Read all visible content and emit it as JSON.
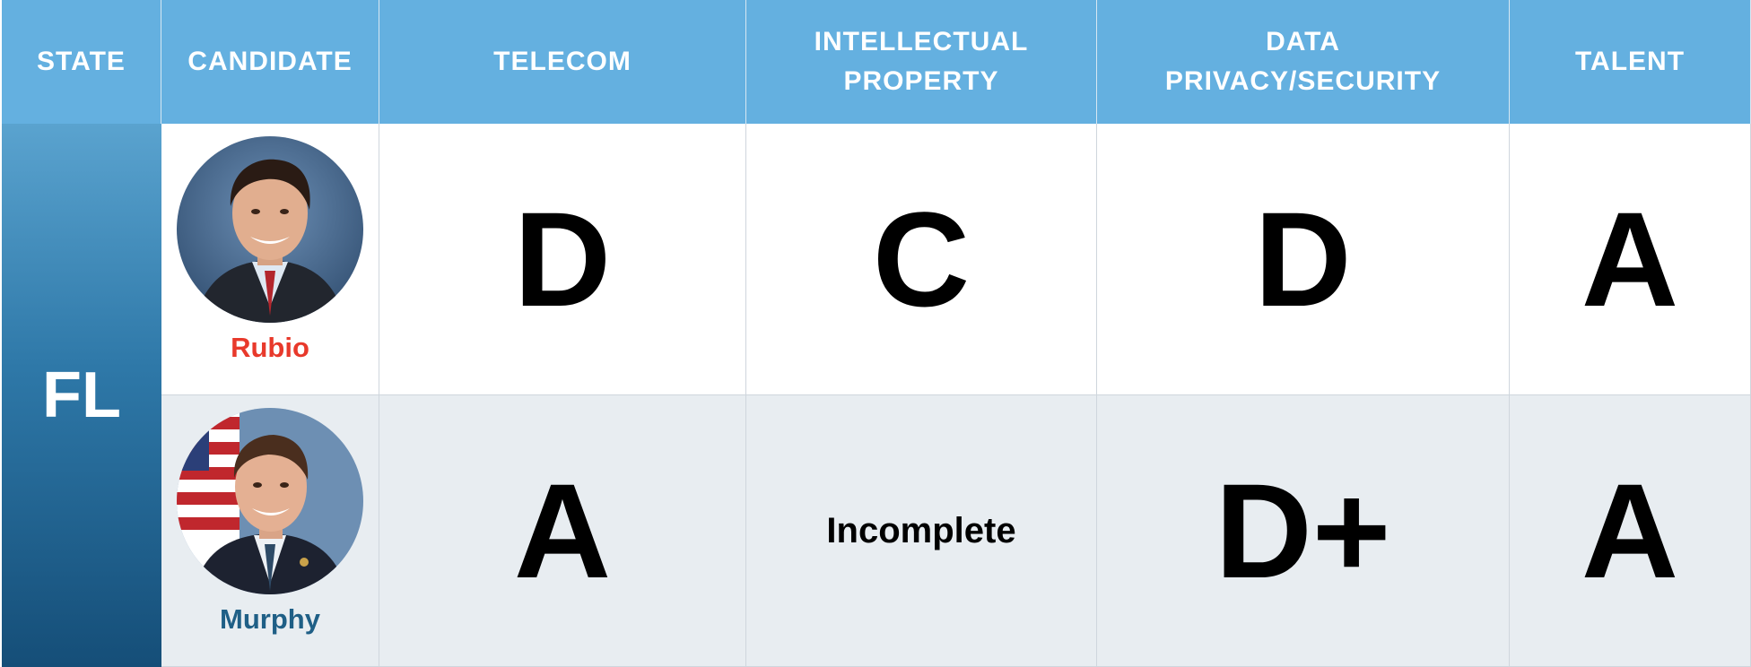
{
  "headers": {
    "state": "STATE",
    "candidate": "CANDIDATE",
    "telecom": "TELECOM",
    "ip": "INTELLECTUAL\nPROPERTY",
    "privacy": "DATA\nPRIVACY/SECURITY",
    "talent": "TALENT"
  },
  "state": "FL",
  "rows": [
    {
      "name": "Rubio",
      "name_color": "#e8392b",
      "telecom": "D",
      "ip": "C",
      "privacy": "D",
      "talent": "A"
    },
    {
      "name": "Murphy",
      "name_color": "#1f5f86",
      "telecom": "A",
      "ip": "Incomplete",
      "privacy": "D+",
      "talent": "A"
    }
  ],
  "colors": {
    "header_bg": "#64b0e0",
    "state_gradient_top": "#5aa3cf",
    "state_gradient_bottom": "#154e78",
    "row_alt_bg": "#e8edf1"
  }
}
